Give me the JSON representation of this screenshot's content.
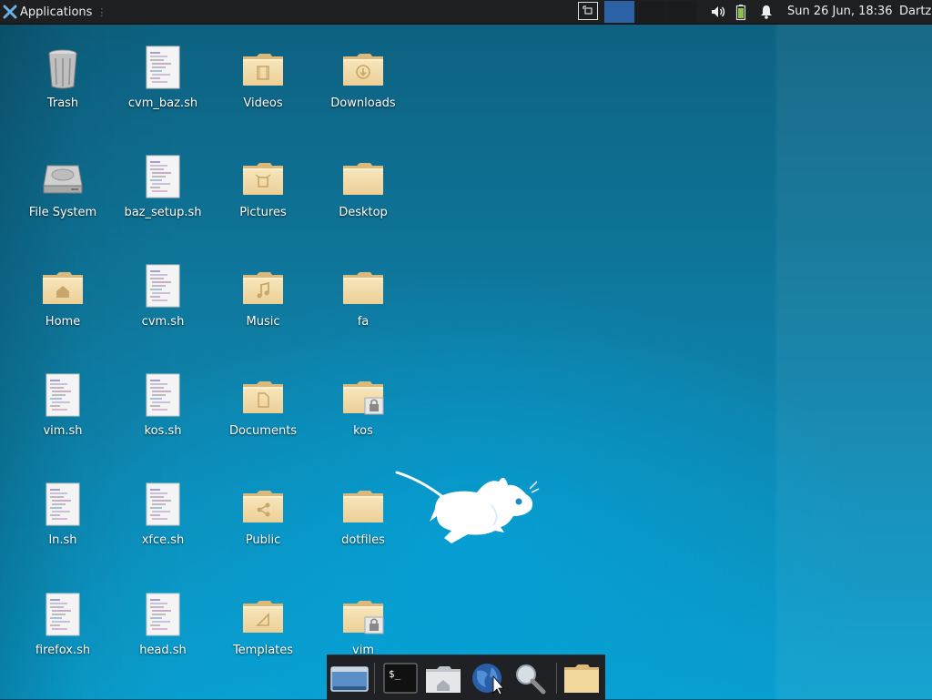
{
  "panel": {
    "applications_label": "Applications",
    "clock": "Sun 26 Jun, 18:36",
    "user": "Dartz",
    "tray_icons": [
      "volume-icon",
      "battery-icon",
      "notification-bell-icon"
    ],
    "workspace_active_color": "#2a62a5"
  },
  "desktop": {
    "icons": [
      {
        "label": "Trash",
        "kind": "trash"
      },
      {
        "label": "cvm_baz.sh",
        "kind": "script"
      },
      {
        "label": "Videos",
        "kind": "folder-videos"
      },
      {
        "label": "Downloads",
        "kind": "folder-downloads"
      },
      {
        "label": "File System",
        "kind": "drive"
      },
      {
        "label": "baz_setup.sh",
        "kind": "script"
      },
      {
        "label": "Pictures",
        "kind": "folder-pictures"
      },
      {
        "label": "Desktop",
        "kind": "folder"
      },
      {
        "label": "Home",
        "kind": "folder-home"
      },
      {
        "label": "cvm.sh",
        "kind": "script"
      },
      {
        "label": "Music",
        "kind": "folder-music"
      },
      {
        "label": "fa",
        "kind": "folder"
      },
      {
        "label": "vim.sh",
        "kind": "script"
      },
      {
        "label": "kos.sh",
        "kind": "script"
      },
      {
        "label": "Documents",
        "kind": "folder-documents"
      },
      {
        "label": "kos",
        "kind": "folder-locked"
      },
      {
        "label": "ln.sh",
        "kind": "script"
      },
      {
        "label": "xfce.sh",
        "kind": "script"
      },
      {
        "label": "Public",
        "kind": "folder-public"
      },
      {
        "label": "dotfiles",
        "kind": "folder"
      },
      {
        "label": "firefox.sh",
        "kind": "script"
      },
      {
        "label": "head.sh",
        "kind": "script"
      },
      {
        "label": "Templates",
        "kind": "folder-templates"
      },
      {
        "label": "vim",
        "kind": "folder-locked"
      }
    ]
  },
  "dock": {
    "items": [
      "show-desktop-icon",
      "terminal-icon",
      "home-folder-icon",
      "web-browser-icon",
      "search-icon",
      "file-manager-icon"
    ]
  },
  "colors": {
    "folder": "#f5dca8",
    "folder_dark": "#e3c184",
    "panel_bg": "#1d1f21"
  }
}
